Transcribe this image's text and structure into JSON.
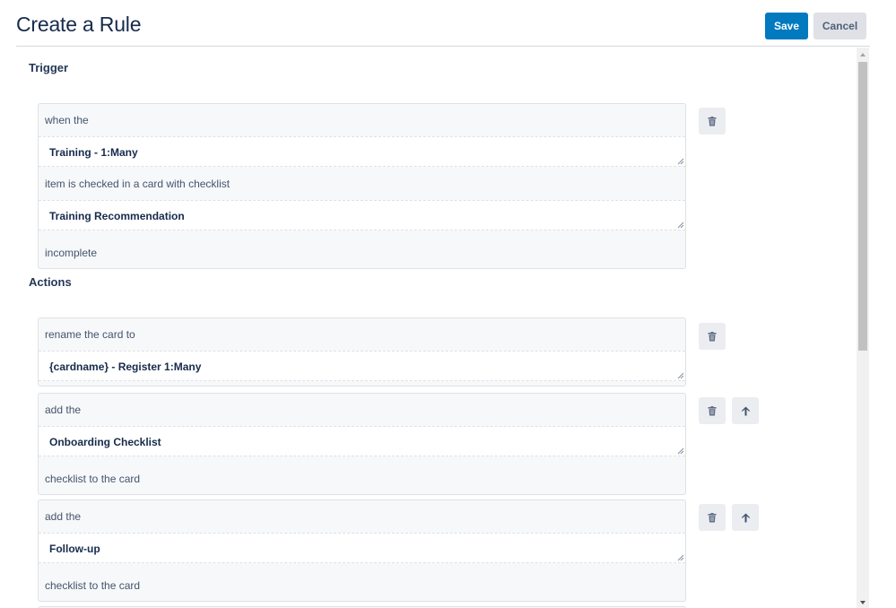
{
  "header": {
    "title": "Create a Rule",
    "save_label": "Save",
    "cancel_label": "Cancel"
  },
  "trigger": {
    "section_title": "Trigger",
    "line1": "when the",
    "field1": "Training - 1:Many",
    "line2": "item is checked in a card with checklist",
    "field2": "Training Recommendation",
    "line3": "incomplete"
  },
  "actions": {
    "section_title": "Actions",
    "items": [
      {
        "line1": "rename the card to",
        "field": "{cardname} - Register 1:Many"
      },
      {
        "line1": "add the",
        "field": "Onboarding Checklist",
        "line2": "checklist to the card"
      },
      {
        "line1": "add the",
        "field": "Follow-up",
        "line2": "checklist to the card"
      }
    ]
  },
  "icons": {
    "delete": "trash-icon",
    "move_up": "arrow-up-icon",
    "resize": "resize-grip-icon"
  },
  "colors": {
    "primary": "#0079bf",
    "secondary_button": "#dfe1e6",
    "text": "#172b4d",
    "box_background": "#f7f8f9"
  }
}
